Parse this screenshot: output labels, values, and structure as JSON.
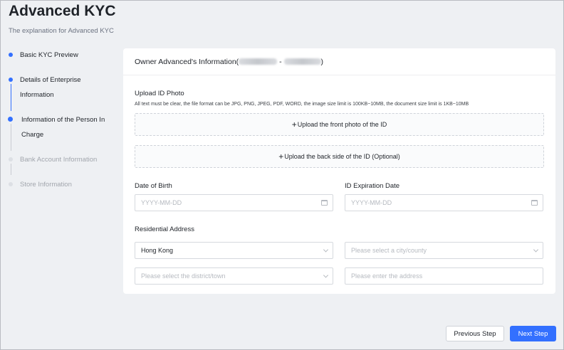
{
  "page": {
    "title": "Advanced KYC",
    "subtitle": "The explanation for Advanced KYC"
  },
  "steps": [
    {
      "label_lines": [
        "Basic KYC Preview"
      ],
      "state": "done"
    },
    {
      "label_lines": [
        "Details of Enterprise",
        "Information"
      ],
      "state": "done"
    },
    {
      "label_lines": [
        "Information of the Person In",
        "Charge"
      ],
      "state": "current"
    },
    {
      "label_lines": [
        "Bank Account Information"
      ],
      "state": "pending"
    },
    {
      "label_lines": [
        "Store Information"
      ],
      "state": "pending"
    }
  ],
  "card": {
    "header_prefix": "Owner Advanced's Information(",
    "header_separator": " - ",
    "header_suffix": ")",
    "upload_id_label": "Upload ID Photo",
    "upload_hint": "All text must be clear, the file format can be JPG, PNG, JPEG, PDF, WORD, the image size limit is 100KB~10MB, the document size limit is 1KB~10MB",
    "upload_front_label": "Upload the front photo of the ID",
    "upload_back_label": "Upload the back side of the ID (Optional)",
    "plus_glyph": "+",
    "dob_label": "Date of Birth",
    "dob_placeholder": "YYYY-MM-DD",
    "expiry_label": "ID Expiration Date",
    "expiry_placeholder": "YYYY-MM-DD",
    "address_label": "Residential Address",
    "region_value": "Hong Kong",
    "city_placeholder": "Please select a city/county",
    "district_placeholder": "Please select the district/town",
    "address_placeholder": "Please enter the address"
  },
  "footer": {
    "prev_label": "Previous Step",
    "next_label": "Next Step"
  },
  "colors": {
    "accent": "#3370ff",
    "background": "#eef0f3"
  },
  "icons": {
    "date": "calendar-icon",
    "select": "chevron-down-icon",
    "upload": "plus-icon"
  }
}
